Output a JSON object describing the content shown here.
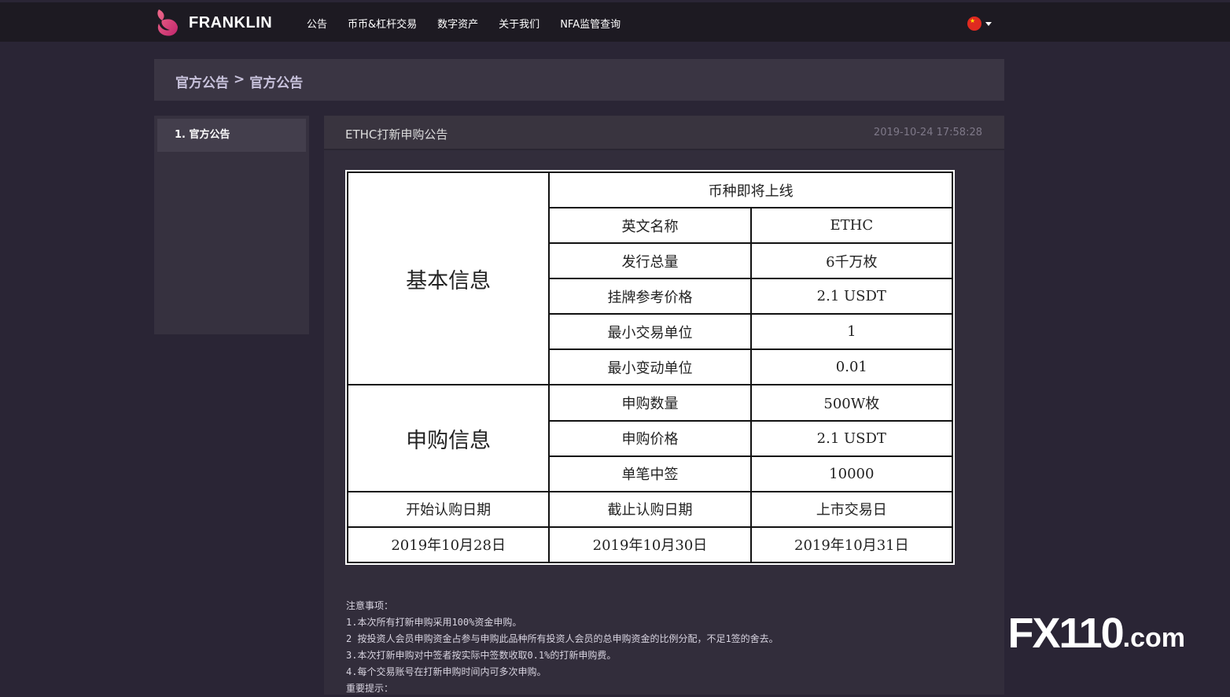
{
  "brand": {
    "name": "FRANKLIN"
  },
  "nav": {
    "items": [
      "公告",
      "币币&杠杆交易",
      "数字资产",
      "关于我们",
      "NFA监管查询"
    ]
  },
  "lang": {
    "flag_icon": "china-flag-icon"
  },
  "breadcrumb": {
    "parent": "官方公告",
    "separator": ">",
    "current": "官方公告"
  },
  "sidebar": {
    "items": [
      {
        "label": "1. 官方公告"
      }
    ]
  },
  "article": {
    "title": "ETHC打新申购公告",
    "timestamp": "2019-10-24 17:58:28"
  },
  "poster": {
    "header": "币种即将上线",
    "section_basic": "基本信息",
    "section_sub": "申购信息",
    "rows": [
      {
        "label": "英文名称",
        "value": "ETHC"
      },
      {
        "label": "发行总量",
        "value": "6千万枚"
      },
      {
        "label": "挂牌参考价格",
        "value": "2.1 USDT"
      },
      {
        "label": "最小交易单位",
        "value": "1"
      },
      {
        "label": "最小变动单位",
        "value": "0.01"
      },
      {
        "label": "申购数量",
        "value": "500W枚"
      },
      {
        "label": "申购价格",
        "value": "2.1 USDT"
      },
      {
        "label": "单笔中签",
        "value": "10000"
      }
    ],
    "date_labels": [
      "开始认购日期",
      "截止认购日期",
      "上市交易日"
    ],
    "date_values": [
      "2019年10月28日",
      "2019年10月30日",
      "2019年10月31日"
    ]
  },
  "notes": {
    "heading": "注意事项：",
    "lines": [
      "1.本次所有打新申购采用100%资金申购。",
      "2 按投资人会员申购资金占参与申购此品种所有投资人会员的总申购资金的比例分配，不足1签的舍去。",
      "3.本次打新申购对中签者按实际中签数收取0.1%的打新申购费。",
      "4.每个交易账号在打新申购时间内可多次申购。"
    ],
    "tail": "重要提示："
  },
  "watermark": {
    "fx": "FX110",
    "domain": ".com"
  }
}
